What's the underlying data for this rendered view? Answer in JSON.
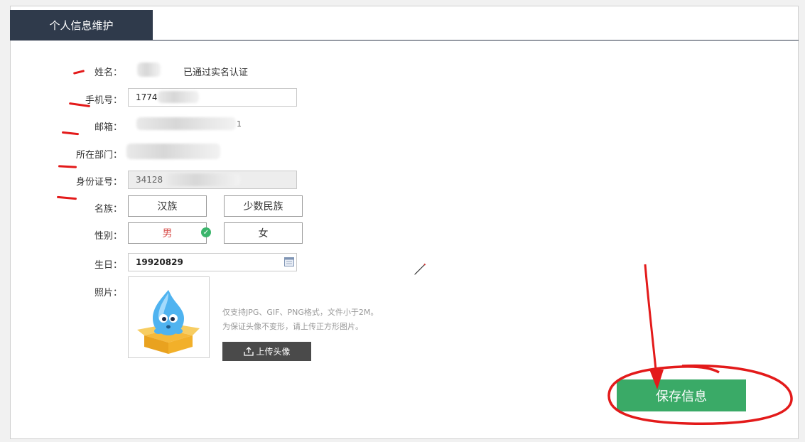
{
  "tab": {
    "title": "个人信息维护"
  },
  "form": {
    "name": {
      "label": "姓名：",
      "verified_text": "已通过实名认证"
    },
    "phone": {
      "label": "手机号：",
      "value": "1774"
    },
    "email": {
      "label": "邮箱：",
      "value_tail": "1"
    },
    "department": {
      "label": "所在部门："
    },
    "id_number": {
      "label": "身份证号：",
      "value": "34128"
    },
    "ethnicity": {
      "label": "名族：",
      "options": [
        "汉族",
        "少数民族"
      ]
    },
    "gender": {
      "label": "性别：",
      "options": [
        "男",
        "女"
      ],
      "selected": "男"
    },
    "birthday": {
      "label": "生日：",
      "value": "19920829"
    },
    "photo": {
      "label": "照片：",
      "hint_line1": "仅支持JPG、GIF、PNG格式，文件小于2M。",
      "hint_line2": "为保证头像不变形，请上传正方形图片。",
      "upload_label": "上传头像"
    }
  },
  "actions": {
    "save_label": "保存信息"
  },
  "colors": {
    "tab_bg": "#2f3a4b",
    "save_bg": "#3aaa67",
    "annotation_red": "#e31a1a",
    "check_green": "#3bb56c",
    "selected_text": "#d9534f"
  }
}
